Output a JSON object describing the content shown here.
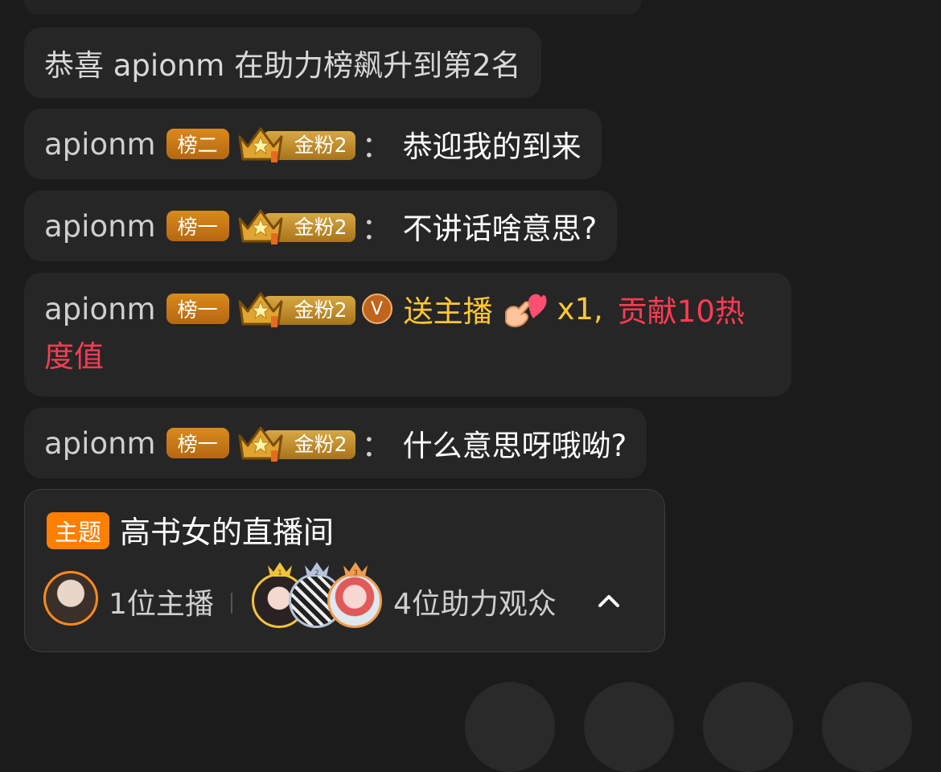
{
  "system_notice": "恭喜 apionm 在助力榜飙升到第2名",
  "messages": [
    {
      "username": "apionm",
      "rank_badge": "榜二",
      "fan_badge": "金粉2",
      "colon": "：",
      "text": "恭迎我的到来"
    },
    {
      "username": "apionm",
      "rank_badge": "榜一",
      "fan_badge": "金粉2",
      "colon": "：",
      "text": "不讲话啥意思?"
    },
    {
      "username": "apionm",
      "rank_badge": "榜一",
      "fan_badge": "金粉2",
      "vip_glyph": "V",
      "gift_action": "送主播",
      "gift_count": "x1,",
      "contribution_part1": "贡献10热",
      "contribution_part2": "度值"
    },
    {
      "username": "apionm",
      "rank_badge": "榜一",
      "fan_badge": "金粉2",
      "colon": "：",
      "text": "什么意思呀哦呦?"
    }
  ],
  "theme": {
    "tag": "主题",
    "title": "高书女的直播间",
    "host_count": "1位主播",
    "supporter_count": "4位助力观众",
    "supporter_ranks": [
      "1",
      "2",
      "3"
    ]
  },
  "colors": {
    "background": "#1b1b1b",
    "bubble": "#262626",
    "rank_badge": "#c77818",
    "fan_badge": "#c0902f",
    "gift_text": "#ffc833",
    "contribution_text": "#ff3b54",
    "theme_tag": "#ff7f00"
  },
  "icons": [
    "crown-icon",
    "vip-badge-icon",
    "heart-gift-icon",
    "chevron-up-icon"
  ]
}
